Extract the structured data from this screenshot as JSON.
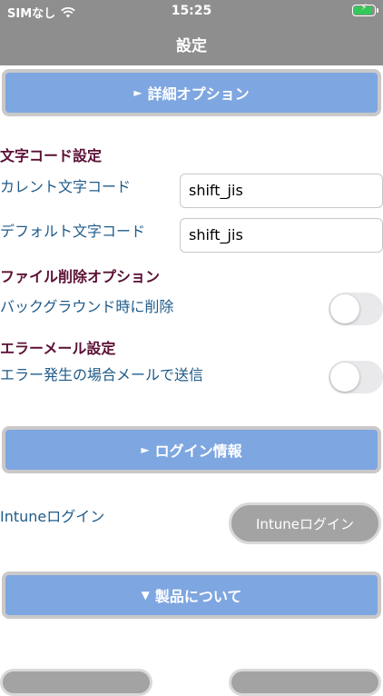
{
  "status_bar": {
    "carrier": "SIMなし",
    "time": "15:25"
  },
  "nav": {
    "title": "設定"
  },
  "sections": {
    "details": {
      "arrow": "►",
      "label": "詳細オプション"
    },
    "login": {
      "arrow": "►",
      "label": "ログイン情報"
    },
    "about": {
      "arrow": "▼",
      "label": "製品について"
    }
  },
  "charset": {
    "heading": "文字コード設定",
    "current_label": "カレント文字コード",
    "current_value": "shift_jis",
    "default_label": "デフォルト文字コード",
    "default_value": "shift_jis"
  },
  "file_delete": {
    "heading": "ファイル削除オプション",
    "background_label": "バックグラウンド時に削除",
    "background_on": false
  },
  "error_mail": {
    "heading": "エラーメール設定",
    "send_label": "エラー発生の場合メールで送信",
    "send_on": false
  },
  "intune": {
    "label": "Intuneログイン",
    "button_label": "Intuneログイン"
  },
  "colors": {
    "accent_button": "#7ea6e0",
    "heading_text": "#5b1035",
    "label_text": "#1f5b8a",
    "navbar": "#8e8e8e"
  }
}
